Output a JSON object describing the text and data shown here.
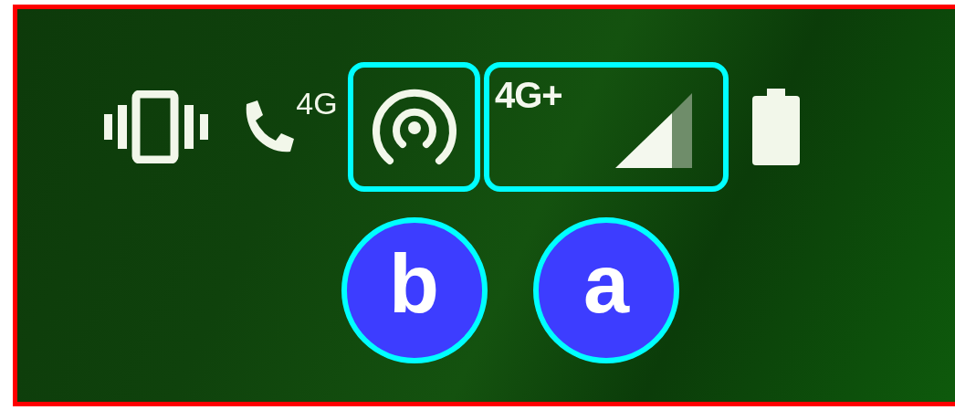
{
  "status_bar": {
    "items": [
      {
        "kind": "vibrate",
        "highlighted": false
      },
      {
        "kind": "call",
        "text": "4G",
        "highlighted": false
      },
      {
        "kind": "hotspot",
        "highlighted": true,
        "callout": "b"
      },
      {
        "kind": "network",
        "text": "4G+",
        "highlighted": true,
        "callout": "a"
      },
      {
        "kind": "battery",
        "highlighted": false
      }
    ]
  }
}
